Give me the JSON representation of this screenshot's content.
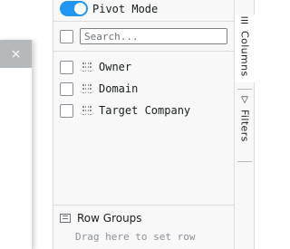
{
  "pivot": {
    "label": "Pivot Mode",
    "enabled": true
  },
  "search": {
    "placeholder": "Search...",
    "value": ""
  },
  "columns": [
    {
      "label": "Owner",
      "checked": false
    },
    {
      "label": "Domain",
      "checked": false
    },
    {
      "label": "Target Company",
      "checked": false
    }
  ],
  "row_groups": {
    "title": "Row Groups",
    "drop_hint": "Drag here to set row"
  },
  "side_tabs": [
    {
      "label": "Columns",
      "icon": "columns-icon"
    },
    {
      "label": "Filters",
      "icon": "filter-icon"
    }
  ],
  "dialog": {
    "close_glyph": "×"
  },
  "colors": {
    "accent": "#2196f3",
    "border": "#d9dde0",
    "panel_bg": "#f8f8f8"
  }
}
